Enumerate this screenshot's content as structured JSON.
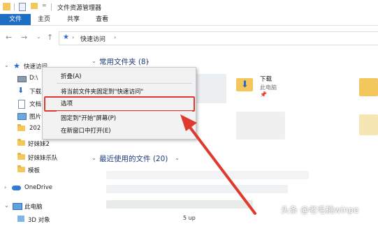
{
  "window": {
    "title": "文件资源管理器"
  },
  "ribbon": {
    "tabs": [
      "文件",
      "主页",
      "共享",
      "查看"
    ]
  },
  "address": {
    "path": "快速访问"
  },
  "nav": {
    "items": [
      {
        "label": "快速访问",
        "icon": "star-icon"
      },
      {
        "label": "D:\\",
        "icon": "drive-icon"
      },
      {
        "label": "下载",
        "icon": "download-icon"
      },
      {
        "label": "文档",
        "icon": "document-icon"
      },
      {
        "label": "图片",
        "icon": "picture-icon"
      },
      {
        "label": "202",
        "icon": "folder-icon"
      },
      {
        "label": "好妹妹2",
        "icon": "folder-icon"
      },
      {
        "label": "好妹妹乐队",
        "icon": "folder-icon"
      },
      {
        "label": "模板",
        "icon": "folder-icon"
      },
      {
        "label": "OneDrive",
        "icon": "cloud-icon"
      },
      {
        "label": "此电脑",
        "icon": "computer-icon"
      },
      {
        "label": "3D 对象",
        "icon": "3d-icon"
      }
    ]
  },
  "content": {
    "frequent_header": "常用文件夹 (8)",
    "recent_header": "最近使用的文件 (20)",
    "downloads_tile": {
      "name": "下载",
      "location": "此电脑"
    },
    "partial_text": "5 up"
  },
  "context_menu": {
    "items": [
      "折叠(A)",
      "将当前文件夹固定到\"快速访问\"",
      "选项",
      "固定到\"开始\"屏幕(P)",
      "在新窗口中打开(E)"
    ]
  },
  "colors": {
    "accent": "#1d6fc4",
    "highlight": "#e03a2e",
    "arrow": "#e03a2e"
  },
  "watermark": "头条 @老毛桃winpe"
}
